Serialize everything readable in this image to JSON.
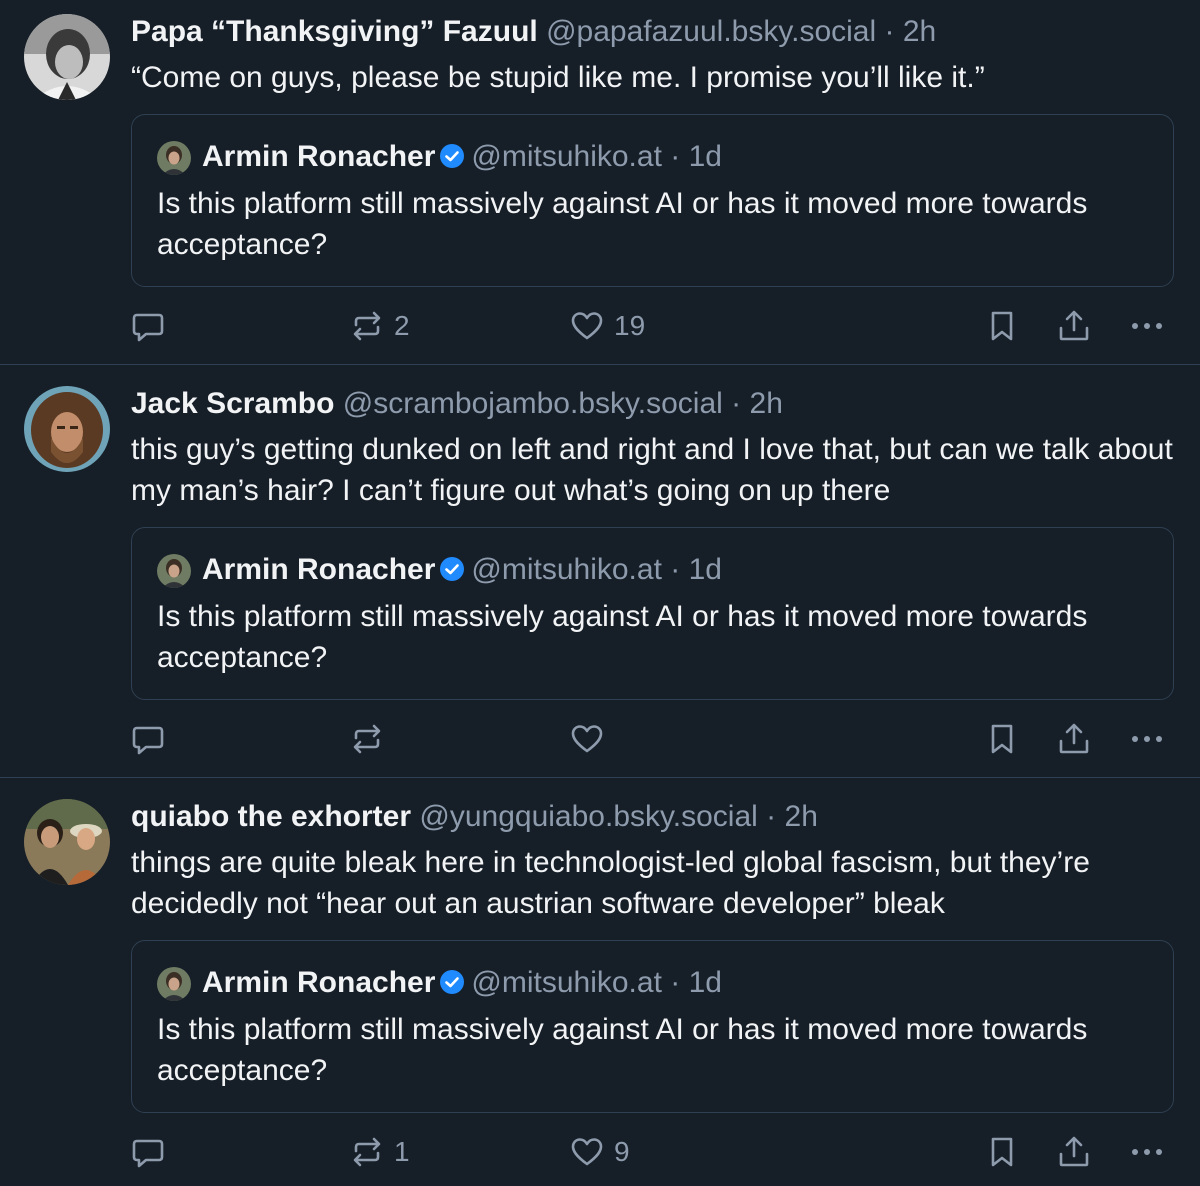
{
  "posts": [
    {
      "author_name": "Papa “Thanksgiving” Fazuul",
      "handle": "@papafazuul.bsky.social",
      "separator": "·",
      "time": "2h",
      "text": "“Come on guys, please be stupid like me. I promise you’ll like it.”",
      "quote": {
        "author_name": "Armin Ronacher",
        "handle": "@mitsuhiko.at",
        "separator": "·",
        "time": "1d",
        "text": "Is this platform still massively against AI or has it moved more towards acceptance?"
      },
      "repost_count": "2",
      "like_count": "19"
    },
    {
      "author_name": "Jack Scrambo",
      "handle": "@scrambojambo.bsky.social",
      "separator": "·",
      "time": "2h",
      "text": "this guy’s getting dunked on left and right and I love that, but can we talk about my man’s hair? I can’t figure out what’s going on up there",
      "quote": {
        "author_name": "Armin Ronacher",
        "handle": "@mitsuhiko.at",
        "separator": "·",
        "time": "1d",
        "text": "Is this platform still massively against AI or has it moved more towards acceptance?"
      },
      "repost_count": "",
      "like_count": ""
    },
    {
      "author_name": "quiabo the exhorter",
      "handle": "@yungquiabo.bsky.social",
      "separator": "·",
      "time": "2h",
      "text": "things are quite bleak here in technologist-led global fascism, but they’re decidedly not “hear out an austrian software developer” bleak",
      "quote": {
        "author_name": "Armin Ronacher",
        "handle": "@mitsuhiko.at",
        "separator": "·",
        "time": "1d",
        "text": "Is this platform still massively against AI or has it moved more towards acceptance?"
      },
      "repost_count": "1",
      "like_count": "9"
    }
  ],
  "icons": {
    "reply": "speech-bubble-icon",
    "repost": "repost-arrows-icon",
    "like": "heart-icon",
    "bookmark": "bookmark-icon",
    "share": "share-icon",
    "more": "ellipsis-icon",
    "verified": "verified-check-icon"
  },
  "colors": {
    "background": "#161e27",
    "text_primary": "#f1f3f5",
    "text_secondary": "#8d9bad",
    "border": "#2e4052",
    "verified": "#208bfe"
  }
}
